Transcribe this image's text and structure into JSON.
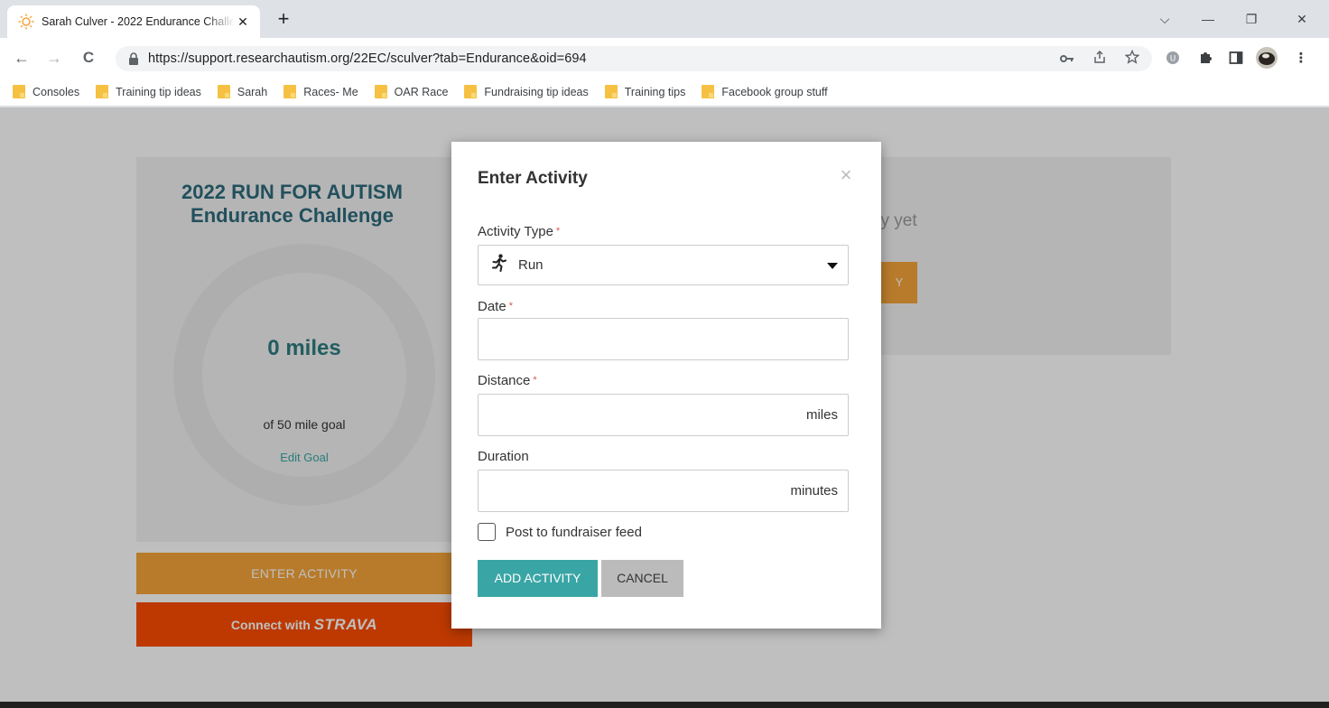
{
  "browser": {
    "tab_title": "Sarah Culver - 2022 Endurance Challenge",
    "tab_close": "✕",
    "new_tab": "+",
    "url": "https://support.researchautism.org/22EC/sculver?tab=Endurance&oid=694",
    "window_controls": {
      "list": "⌵",
      "minimize": "—",
      "restore": "❐",
      "close": "✕"
    },
    "nav": {
      "back": "←",
      "forward": "→",
      "reload": "C"
    },
    "bookmarks": [
      "Consoles",
      "Training tip ideas",
      "Sarah",
      "Races- Me",
      "OAR Race",
      "Fundraising tip ideas",
      "Training tips",
      "Facebook group stuff"
    ]
  },
  "page": {
    "challenge_title_line1": "2022 RUN FOR AUTISM",
    "challenge_title_line2": "Endurance Challenge",
    "miles_value": "0 miles",
    "miles_goal": "of 50 mile goal",
    "edit_goal": "Edit Goal",
    "enter_activity": "ENTER ACTIVITY",
    "strava_prefix": "Connect with ",
    "strava_logo": "STRAVA",
    "no_activity_text": "ity yet",
    "right_button_text": "Y"
  },
  "modal": {
    "title": "Enter Activity",
    "close": "×",
    "activity_type_label": "Activity Type",
    "activity_type_value": "Run",
    "date_label": "Date",
    "date_value": "",
    "distance_label": "Distance",
    "distance_value": "",
    "distance_unit": "miles",
    "duration_label": "Duration",
    "duration_value": "",
    "duration_unit": "minutes",
    "required_marker": "*",
    "post_checkbox_label": "Post to fundraiser feed",
    "post_checkbox_checked": false,
    "add_button": "ADD ACTIVITY",
    "cancel_button": "CANCEL"
  },
  "colors": {
    "teal": "#3aa5a5",
    "orange": "#f4a53a",
    "strava": "#fc4c02",
    "title_blue": "#2e6b7d"
  }
}
